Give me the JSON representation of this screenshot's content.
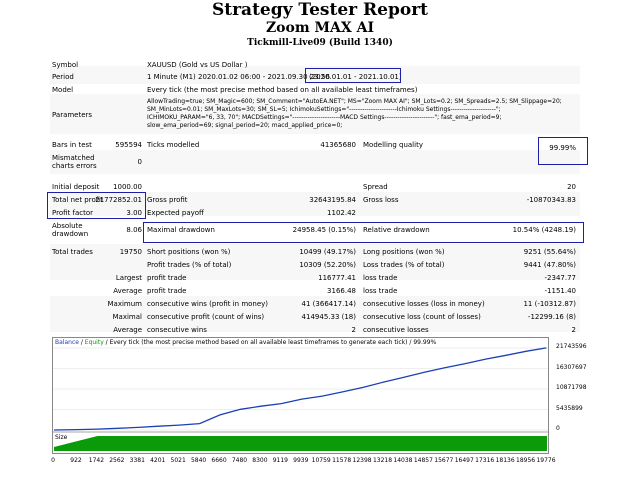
{
  "report": {
    "title": "Strategy Tester Report",
    "ea_name": "Zoom MAX AI",
    "server": "Tickmill-Live09 (Build 1340)"
  },
  "settings": {
    "symbol_label": "Symbol",
    "symbol_value": "XAUUSD (Gold vs US Dollar )",
    "period_label": "Period",
    "period_value": "1 Minute (M1) 2020.01.02 06:00 - 2021.09.30 23:56",
    "period_highlight": "(2020.01.01 - 2021.10.01)",
    "model_label": "Model",
    "model_value": "Every tick (the most precise method based on all available least timeframes)",
    "parameters_label": "Parameters",
    "parameters_lines": [
      "AllowTrading=true; SM_Magic=600; SM_Comment=\"AutoEA.NET\"; MS=\"Zoom MAX AI\"; SM_Lots=0.2; SM_Spreads=2.5; SM_Slippage=20;",
      "SM_MinLots=0.01; SM_MaxLots=30; SM_SL=5; IchimokuSettings=\"----------------------Ichimoku Settings---------------------\";",
      "ICHIMOKU_PARAM=\"6, 33, 70\"; MACDSettings=\"----------------------MACD Settings-----------------------\"; fast_ema_period=9;",
      "slow_ema_period=69; signal_period=20; macd_applied_price=0;"
    ]
  },
  "stats": {
    "bars_label": "Bars in test",
    "bars_value": "595594",
    "ticks_label": "Ticks modelled",
    "ticks_value": "41365680",
    "quality_label": "Modelling quality",
    "quality_value": "99.99%",
    "mismatched_label_1": "Mismatched",
    "mismatched_label_2": "charts errors",
    "mismatched_value": "0",
    "deposit_label": "Initial deposit",
    "deposit_value": "1000.00",
    "spread_label": "Spread",
    "spread_value": "20",
    "net_label": "Total net profit",
    "net_value": "21772852.01",
    "gross_profit_label": "Gross profit",
    "gross_profit_value": "32643195.84",
    "gross_loss_label": "Gross loss",
    "gross_loss_value": "-10870343.83",
    "pf_label": "Profit factor",
    "pf_value": "3.00",
    "payoff_label": "Expected payoff",
    "payoff_value": "1102.42",
    "abs_dd_label_1": "Absolute",
    "abs_dd_label_2": "drawdown",
    "abs_dd_value": "8.06",
    "max_dd_label": "Maximal drawdown",
    "max_dd_value": "24958.45 (0.15%)",
    "rel_dd_label": "Relative drawdown",
    "rel_dd_value": "10.54% (4248.19)",
    "trades_label": "Total trades",
    "trades_value": "19750",
    "short_label": "Short positions (won %)",
    "short_value": "10499 (49.17%)",
    "long_label": "Long positions (won %)",
    "long_value": "9251 (55.64%)",
    "profit_trades_label": "Profit trades (% of total)",
    "profit_trades_value": "10309 (52.20%)",
    "loss_trades_label": "Loss trades (% of total)",
    "loss_trades_value": "9441 (47.80%)",
    "largest_label": "Largest",
    "largest_profit_label": "profit trade",
    "largest_profit_value": "116777.41",
    "largest_loss_label": "loss trade",
    "largest_loss_value": "-2347.77",
    "average_label": "Average",
    "average_profit_label": "profit trade",
    "average_profit_value": "3166.48",
    "average_loss_label": "loss trade",
    "average_loss_value": "-1151.40",
    "maximum_label": "Maximum",
    "max_cons_wins_label": "consecutive wins (profit in money)",
    "max_cons_wins_value": "41 (366417.14)",
    "max_cons_losses_label": "consecutive losses (loss in money)",
    "max_cons_losses_value": "11 (-10312.87)",
    "maximal_label": "Maximal",
    "maximal_cons_profit_label": "consecutive profit (count of wins)",
    "maximal_cons_profit_value": "414945.33 (18)",
    "maximal_cons_loss_label": "consecutive loss (count of losses)",
    "maximal_cons_loss_value": "-12299.16 (8)",
    "avg_cons_wins_label": "consecutive wins",
    "avg_cons_wins_value": "2",
    "avg_cons_losses_label": "consecutive losses",
    "avg_cons_losses_value": "2"
  },
  "chart": {
    "legend_balance": "Balance",
    "legend_sep1": " / ",
    "legend_equity": "Equity",
    "legend_rest": " / Every tick (the most precise method based on all available least timeframes to generate each tick) / 99.99%",
    "size_label": "Size",
    "colors": {
      "balance": "#1c3fb5",
      "size": "#0a9a0a",
      "highlight": "#1e1ea8"
    }
  },
  "chart_data": {
    "type": "line",
    "series": [
      {
        "name": "Balance",
        "x": [
          0,
          922,
          1742,
          2562,
          3381,
          4201,
          5021,
          5840,
          6660,
          7480,
          8300,
          9119,
          9939,
          10759,
          11578,
          12398,
          13218,
          14038,
          14857,
          15677,
          16497,
          17316,
          18136,
          18956,
          19750
        ],
        "values": [
          1000,
          100000,
          250000,
          450000,
          700000,
          1000000,
          1300000,
          1700000,
          4000000,
          5500000,
          6300000,
          7000000,
          8200000,
          9000000,
          10100000,
          11300000,
          12700000,
          14000000,
          15300000,
          16500000,
          17600000,
          18800000,
          19800000,
          20900000,
          21773852
        ]
      }
    ],
    "y_ticks": [
      "21743596",
      "16307697",
      "10871798",
      "5435899",
      "0"
    ],
    "x_ticks": [
      "0",
      "922",
      "1742",
      "2562",
      "3381",
      "4201",
      "5021",
      "5840",
      "6660",
      "7480",
      "8300",
      "9119",
      "9939",
      "10759",
      "11578",
      "12398",
      "13218",
      "14038",
      "14857",
      "15677",
      "16497",
      "17316",
      "18136",
      "18956",
      "19776"
    ],
    "ylim": [
      0,
      21743596
    ],
    "xlim": [
      0,
      19776
    ]
  }
}
